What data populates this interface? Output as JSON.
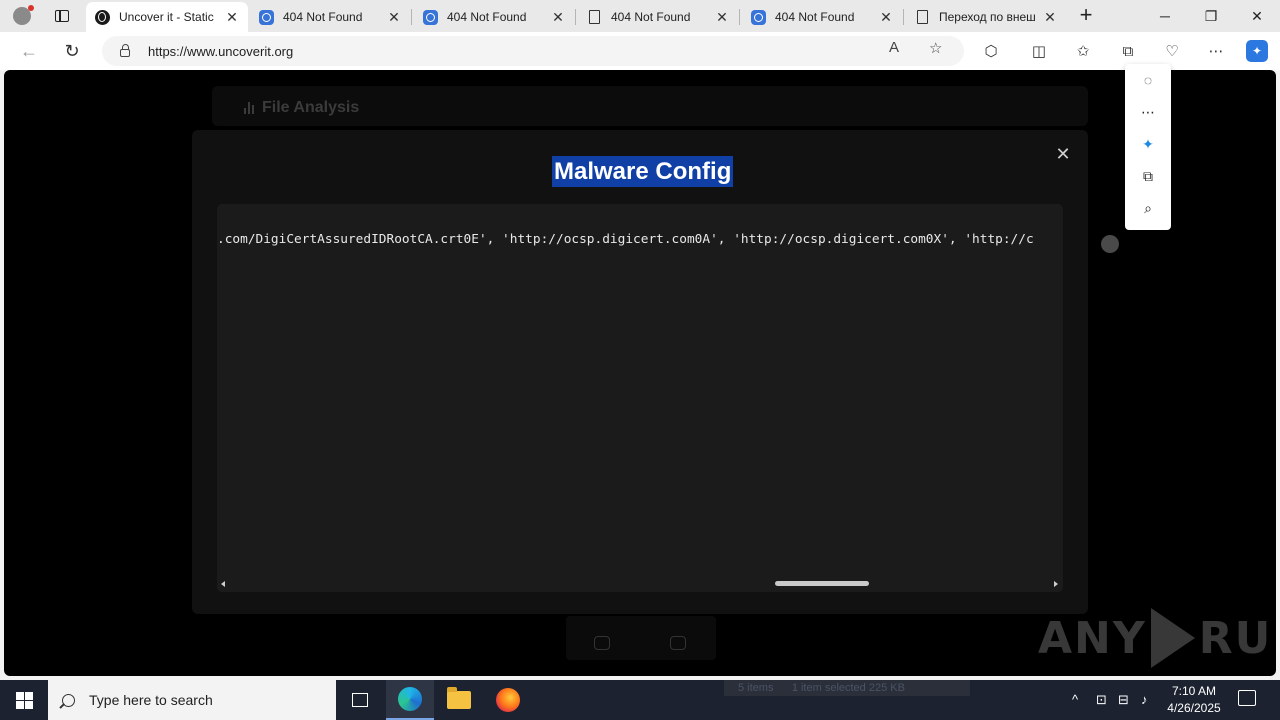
{
  "browser": {
    "tabs": [
      {
        "title": "Uncover it - Static",
        "favicon": "uncover-icon",
        "active": true
      },
      {
        "title": "404 Not Found",
        "favicon": "shield-icon",
        "active": false
      },
      {
        "title": "404 Not Found",
        "favicon": "shield-icon",
        "active": false
      },
      {
        "title": "404 Not Found",
        "favicon": "document-icon",
        "active": false
      },
      {
        "title": "404 Not Found",
        "favicon": "shield-icon",
        "active": false
      },
      {
        "title": "Переход по внеш",
        "favicon": "document-icon",
        "active": false
      }
    ],
    "url": "https://www.uncoverit.org"
  },
  "page": {
    "section_title": "File Analysis",
    "modal": {
      "title": "Malware Config",
      "code_line": ".com/DigiCertAssuredIDRootCA.crt0E', 'http://ocsp.digicert.com0A', 'http://ocsp.digicert.com0X', 'http://c"
    }
  },
  "side_menu": {
    "items": [
      "hide-icon",
      "more-icon",
      "copilot-icon",
      "copy-icon",
      "search-icon"
    ]
  },
  "watermark": {
    "left": "ANY",
    "right": "RUN"
  },
  "taskbar": {
    "search_placeholder": "Type here to search",
    "explorer_status_items": "5 items",
    "explorer_status_selected": "1 item selected  225 KB",
    "time": "7:10 AM",
    "date": "4/26/2025"
  }
}
